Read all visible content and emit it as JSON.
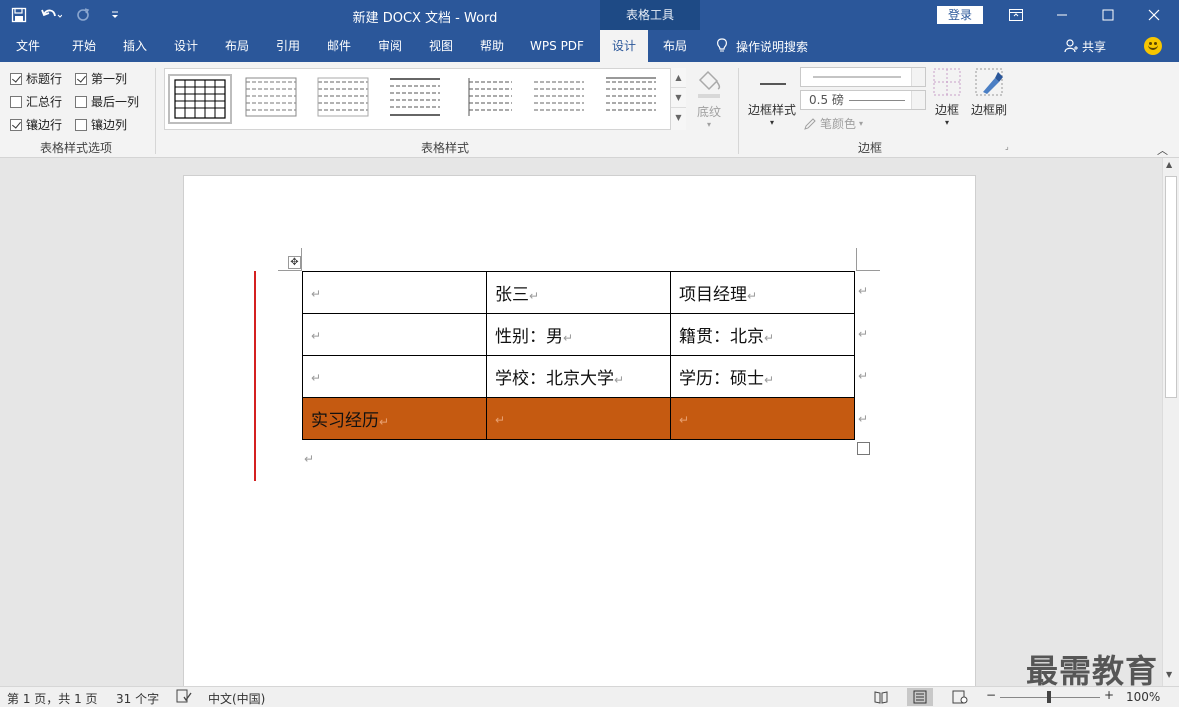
{
  "window": {
    "title": "新建 DOCX 文档  -  Word",
    "context_tab_header": "表格工具",
    "login_label": "登录"
  },
  "tabs": [
    {
      "label": "文件"
    },
    {
      "label": "开始"
    },
    {
      "label": "插入"
    },
    {
      "label": "设计"
    },
    {
      "label": "布局"
    },
    {
      "label": "引用"
    },
    {
      "label": "邮件"
    },
    {
      "label": "审阅"
    },
    {
      "label": "视图"
    },
    {
      "label": "帮助"
    },
    {
      "label": "WPS PDF"
    },
    {
      "label": "设计",
      "active": true
    },
    {
      "label": "布局"
    }
  ],
  "tell_me": "操作说明搜索",
  "share": "共享",
  "ribbon": {
    "style_options": {
      "group_label": "表格样式选项",
      "items": [
        {
          "label": "标题行",
          "checked": true
        },
        {
          "label": "第一列",
          "checked": true
        },
        {
          "label": "汇总行",
          "checked": false
        },
        {
          "label": "最后一列",
          "checked": false
        },
        {
          "label": "镶边行",
          "checked": true
        },
        {
          "label": "镶边列",
          "checked": false
        }
      ]
    },
    "table_styles": {
      "group_label": "表格样式",
      "shading_label": "底纹"
    },
    "borders": {
      "group_label": "边框",
      "border_styles_label": "边框样式",
      "weight_value": "0.5 磅",
      "pen_color_label": "笔颜色",
      "borders_label": "边框",
      "border_painter_label": "边框刷"
    }
  },
  "document": {
    "para_mark": "↵",
    "rows": [
      {
        "cells": [
          "",
          "张三",
          "项目经理"
        ],
        "shaded": false
      },
      {
        "cells": [
          "",
          "性别：男",
          "籍贯：北京"
        ],
        "shaded": false
      },
      {
        "cells": [
          "",
          "学校：北京大学",
          "学历：硕士"
        ],
        "shaded": false
      },
      {
        "cells": [
          "实习经历",
          "",
          ""
        ],
        "shaded": true
      }
    ],
    "shade_color": "#c55a11"
  },
  "statusbar": {
    "page": "第 1 页，共 1 页",
    "words": "31 个字",
    "language": "中文(中国)",
    "zoom": "100%"
  },
  "watermark": "最需教育",
  "colors": {
    "accent": "#2b579a"
  }
}
